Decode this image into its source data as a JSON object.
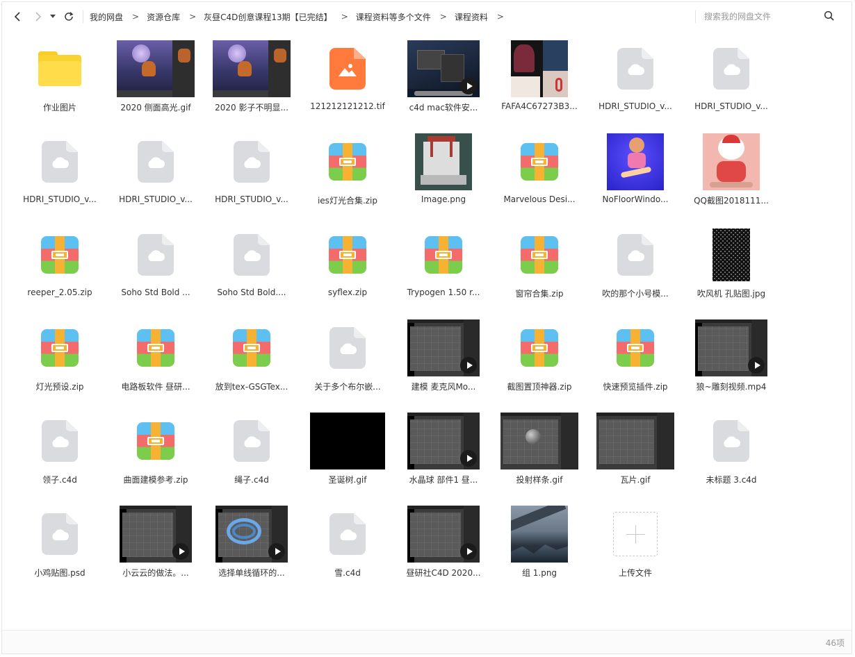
{
  "toolbar": {
    "breadcrumb": [
      "我的网盘",
      "资源仓库",
      "灰昼C4D创意课程13期【已完结】",
      "课程资料等多个文件",
      "课程资料"
    ],
    "search_placeholder": "搜索我的网盘文件"
  },
  "files": [
    {
      "name": "作业图片",
      "type": "folder"
    },
    {
      "name": "2020 侧面高光.gif",
      "type": "thumb-c4d-purple"
    },
    {
      "name": "2020 影子不明显...",
      "type": "thumb-c4d-purple"
    },
    {
      "name": "121212121212.tif",
      "type": "image"
    },
    {
      "name": "c4d mac软件安...",
      "type": "thumb-video-mac"
    },
    {
      "name": "FAFA4C67273B3...",
      "type": "thumb-collage"
    },
    {
      "name": "HDRI_STUDIO_v...",
      "type": "generic"
    },
    {
      "name": "HDRI_STUDIO_v...",
      "type": "generic"
    },
    {
      "name": "HDRI_STUDIO_v...",
      "type": "generic"
    },
    {
      "name": "HDRI_STUDIO_v...",
      "type": "generic"
    },
    {
      "name": "HDRI_STUDIO_v...",
      "type": "generic"
    },
    {
      "name": "ies灯光合集.zip",
      "type": "zip"
    },
    {
      "name": "Image.png",
      "type": "thumb-temple"
    },
    {
      "name": "Marvelous Desi...",
      "type": "zip"
    },
    {
      "name": "NoFloorWindo...",
      "type": "thumb-blue-char"
    },
    {
      "name": "QQ截图2018111...",
      "type": "thumb-pink-char"
    },
    {
      "name": "reeper_2.05.zip",
      "type": "zip"
    },
    {
      "name": "Soho Std Bold ...",
      "type": "generic"
    },
    {
      "name": "Soho Std Bold....",
      "type": "generic"
    },
    {
      "name": "syflex.zip",
      "type": "zip"
    },
    {
      "name": "Trypogen 1.50 r...",
      "type": "zip"
    },
    {
      "name": "窗帘合集.zip",
      "type": "zip"
    },
    {
      "name": "吹的那个小号模...",
      "type": "generic"
    },
    {
      "name": "吹风机 孔贴图.jpg",
      "type": "thumb-holes"
    },
    {
      "name": "灯光预设.zip",
      "type": "zip"
    },
    {
      "name": "电路板软件 昼研...",
      "type": "zip"
    },
    {
      "name": "放到tex-GSGTex...",
      "type": "zip"
    },
    {
      "name": "关于多个布尔嵌...",
      "type": "generic"
    },
    {
      "name": "建模  麦克风Mo...",
      "type": "thumb-video-ui"
    },
    {
      "name": "截图置顶神器.zip",
      "type": "zip"
    },
    {
      "name": "快速预览插件.zip",
      "type": "zip"
    },
    {
      "name": "狼~雕刻视频.mp4",
      "type": "thumb-video-ui"
    },
    {
      "name": "领子.c4d",
      "type": "generic"
    },
    {
      "name": "曲面建模参考.zip",
      "type": "zip"
    },
    {
      "name": "绳子.c4d",
      "type": "generic"
    },
    {
      "name": "圣诞树.gif",
      "type": "thumb-black"
    },
    {
      "name": "水晶球 部件1 昼...",
      "type": "thumb-video-ui"
    },
    {
      "name": "投射样条.gif",
      "type": "thumb-ui-sphere"
    },
    {
      "name": "瓦片.gif",
      "type": "thumb-ui-plain"
    },
    {
      "name": "未标题 3.c4d",
      "type": "generic"
    },
    {
      "name": "小鸡贴图.psd",
      "type": "generic"
    },
    {
      "name": "小云云的做法。...",
      "type": "thumb-video-ui"
    },
    {
      "name": "选择单线循环的...",
      "type": "thumb-video-rings"
    },
    {
      "name": "雪.c4d",
      "type": "generic"
    },
    {
      "name": "昼研社C4D 2020...",
      "type": "thumb-video-ui"
    },
    {
      "name": "组 1.png",
      "type": "thumb-landscape"
    },
    {
      "name": "上传文件",
      "type": "upload"
    }
  ],
  "footer": {
    "count": "46项"
  },
  "colors": {
    "folder": "#fbd331",
    "image_icon": "#ff7a3c",
    "generic_icon": "#d9dbde"
  }
}
